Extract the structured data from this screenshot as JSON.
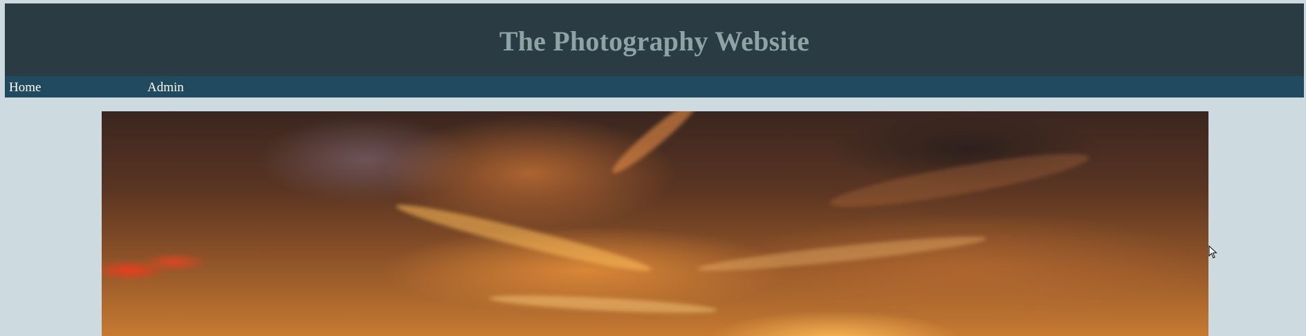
{
  "header": {
    "title": "The Photography Website"
  },
  "nav": {
    "items": [
      {
        "label": "Home"
      },
      {
        "label": "Admin"
      }
    ]
  },
  "main": {
    "hero_image": "sunset-clouds-photo"
  },
  "colors": {
    "page_background": "#cddbe1",
    "header_background": "#2b3b44",
    "title_text": "#8fa3a5",
    "nav_background": "#214a5e",
    "nav_text": "#ffffff"
  }
}
